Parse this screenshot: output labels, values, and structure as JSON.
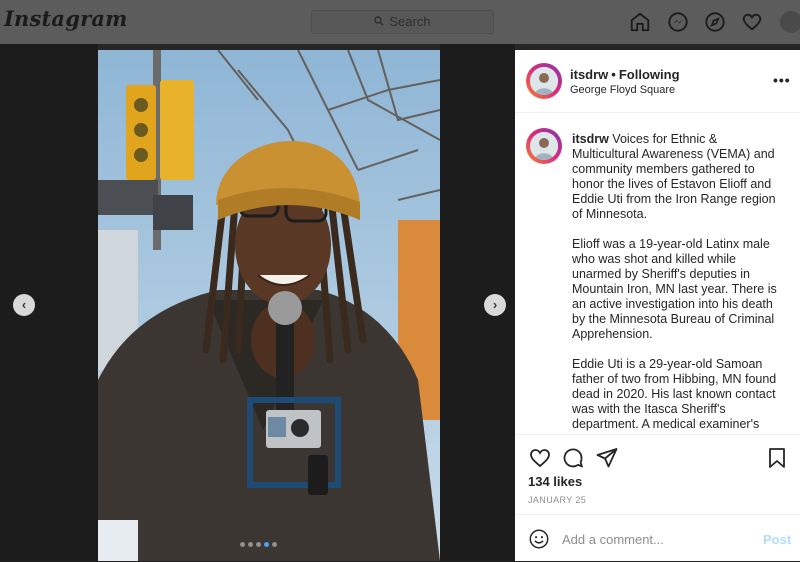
{
  "nav": {
    "logo": "Instagram",
    "search_placeholder": "Search",
    "icons": [
      "home-icon",
      "messenger-icon",
      "explore-icon",
      "heart-icon",
      "avatar"
    ]
  },
  "carousel": {
    "prev_icon": "chevron-left-icon",
    "next_icon": "chevron-right-icon",
    "dots_total": 5,
    "active_index": 3
  },
  "post": {
    "username": "itsdrw",
    "separator": "•",
    "follow_status": "Following",
    "location": "George Floyd Square",
    "more": "•••",
    "caption_paragraphs": [
      "Voices for Ethnic & Multicultural Awareness (VEMA) and community members gathered to honor the lives of Estavon Elioff and Eddie Uti from the Iron Range region of Minnesota.",
      "Elioff was a 19-year-old Latinx male who was shot and killed while unarmed by Sheriff's deputies in Mountain Iron, MN last year. There is an active investigation into his death by the Minnesota Bureau of Criminal Apprehension.",
      "Eddie Uti is a 29-year-old Samoan father of two from Hibbing, MN found dead in 2020. His last known contact was with the Itasca Sheriff's department. A medical examiner's"
    ],
    "likes": "134 likes",
    "date": "JANUARY 25",
    "comment_placeholder": "Add a comment...",
    "post_label": "Post"
  },
  "colors": {
    "accent_disabled": "#b3dbff",
    "active_dot": "#4aa3f5"
  }
}
